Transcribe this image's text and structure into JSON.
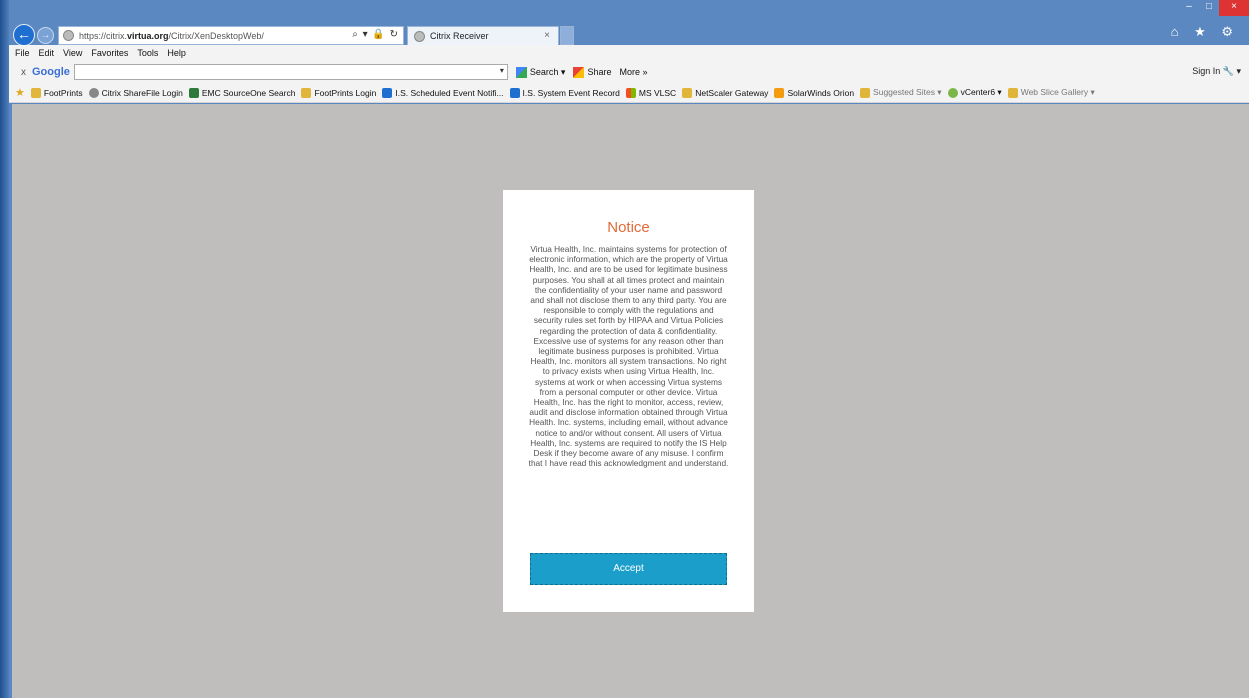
{
  "browser": {
    "url_prefix": "https://citrix.",
    "url_domain": "virtua.org",
    "url_path": "/Citrix/XenDesktopWeb/",
    "address_tools": "⌕ ▾ 🔒 ↻",
    "tab_title": "Citrix Receiver",
    "tab_close": "×",
    "window_controls": [
      "–",
      "□",
      "×"
    ],
    "top_icons": "⌂ ★ ⚙"
  },
  "menubar": {
    "items": [
      "File",
      "Edit",
      "View",
      "Favorites",
      "Tools",
      "Help"
    ]
  },
  "google_toolbar": {
    "close": "x",
    "logo": "Google",
    "search_button": "Search ▾",
    "share_button": "Share",
    "more_button": "More »",
    "signin": "Sign In 🔧 ▾"
  },
  "favorites": [
    {
      "label": "FootPrints",
      "icon": "ie-page-icon",
      "color": "#e0b53a",
      "grey": false
    },
    {
      "label": "Citrix ShareFile Login",
      "icon": "citrix-icon",
      "color": "#888888",
      "grey": false
    },
    {
      "label": "EMC SourceOne Search",
      "icon": "emc-icon",
      "color": "#2d7a3a",
      "grey": false
    },
    {
      "label": "FootPrints Login",
      "icon": "ie-page-icon",
      "color": "#e0b53a",
      "grey": false
    },
    {
      "label": "I.S. Scheduled Event Notifi...",
      "icon": "sharepoint-icon",
      "color": "#1f6fd0",
      "grey": false
    },
    {
      "label": "I.S. System Event Record",
      "icon": "sharepoint-icon",
      "color": "#1f6fd0",
      "grey": false
    },
    {
      "label": "MS VLSC",
      "icon": "microsoft-icon",
      "color": "#e74c3c",
      "grey": false
    },
    {
      "label": "NetScaler Gateway",
      "icon": "ie-page-icon",
      "color": "#e0b53a",
      "grey": false
    },
    {
      "label": "SolarWinds Orion",
      "icon": "solarwinds-icon",
      "color": "#f39c12",
      "grey": false
    },
    {
      "label": "Suggested Sites ▾",
      "icon": "ie-page-icon",
      "color": "#e0b53a",
      "grey": true
    },
    {
      "label": "vCenter6 ▾",
      "icon": "vcenter-icon",
      "color": "#7ab648",
      "grey": false
    },
    {
      "label": "Web Slice Gallery ▾",
      "icon": "ie-page-icon",
      "color": "#e0b53a",
      "grey": true
    }
  ],
  "notice": {
    "title": "Notice",
    "body": "Virtua Health, Inc. maintains systems for protection of electronic information, which are the property of Virtua Health, Inc. and are to be used for legitimate business purposes. You shall at all times protect and maintain the confidentiality of your user name and password and shall not disclose them to any third party. You are responsible to comply with the regulations and security rules set forth by HIPAA and Virtua Policies regarding the protection of data & confidentiality. Excessive use of systems for any reason other than legitimate business purposes is prohibited. Virtua Health, Inc. monitors all system transactions. No right to privacy exists when using Virtua Health, Inc. systems at work or when accessing Virtua systems from a personal computer or other device. Virtua Health, Inc. has the right to monitor, access, review, audit and disclose information obtained through Virtua Health. Inc. systems, including email, without advance notice to and/or without consent. All users of Virtua Health, Inc. systems are required to notify the IS Help Desk if they become aware of any misuse. I confirm that I have read this acknowledgment and understand.",
    "accept_label": "Accept"
  },
  "colors": {
    "notice_title": "#e06a3a",
    "accept_button": "#1b9ec9",
    "content_background": "#c0bdbd"
  }
}
